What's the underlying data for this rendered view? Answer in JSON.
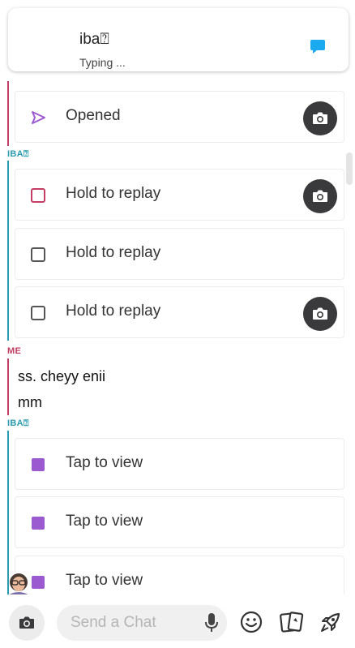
{
  "header": {
    "name": "iba⍰",
    "status": "Typing ..."
  },
  "labels": {
    "them": "IBA⍰",
    "me": "ME"
  },
  "rows_top": [
    {
      "label": "Opened"
    }
  ],
  "rows_group1": [
    {
      "label": "Hold to replay"
    },
    {
      "label": "Hold to replay"
    },
    {
      "label": "Hold to replay"
    }
  ],
  "messages": [
    "ss. cheyy enii",
    "mm"
  ],
  "rows_group2": [
    {
      "label": "Tap to view"
    },
    {
      "label": "Tap to view"
    },
    {
      "label": "Tap to view"
    }
  ],
  "composer": {
    "placeholder": "Send a Chat"
  },
  "colors": {
    "them": "#2a9bb0",
    "me": "#c43d63",
    "purple": "#9c5ad0",
    "accent_blue": "#1ba9f0"
  }
}
